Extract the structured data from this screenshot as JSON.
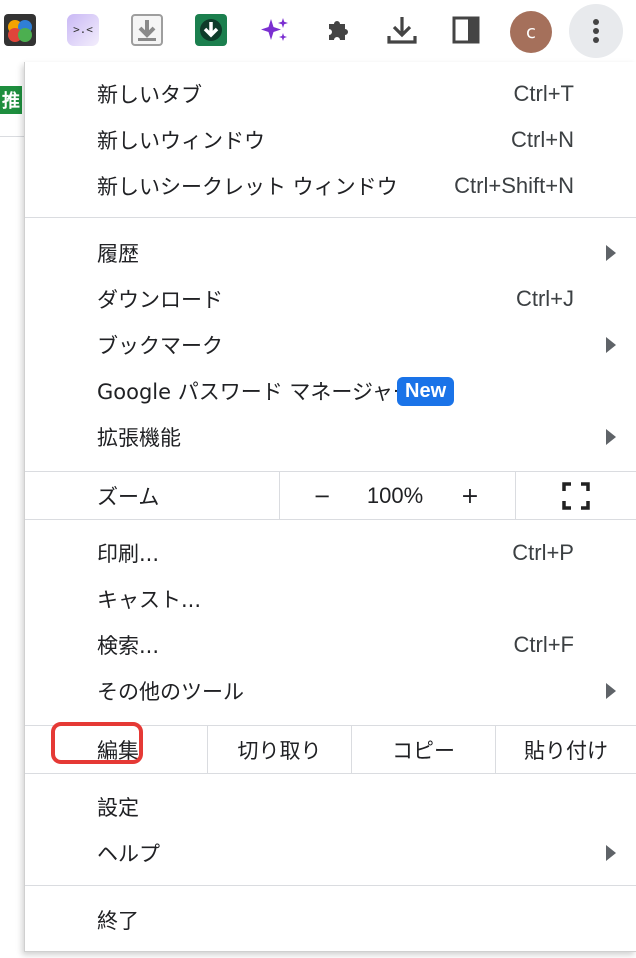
{
  "toolbar": {
    "extensions": [
      {
        "icon": "brain-extension-icon"
      },
      {
        "icon": "face-extension-icon",
        "glyph": ">.<"
      },
      {
        "icon": "download-arrow-extension-icon"
      },
      {
        "icon": "green-shield-download-icon"
      },
      {
        "icon": "sparkle-icon"
      },
      {
        "icon": "puzzle-extensions-icon"
      },
      {
        "icon": "downloads-icon"
      },
      {
        "icon": "side-panel-icon"
      }
    ],
    "avatar_letter": "c",
    "menu_icon": "three-dots-vertical-icon"
  },
  "page": {
    "badge_text": "推"
  },
  "menu": {
    "section1": [
      {
        "label": "新しいタブ",
        "shortcut": "Ctrl+T"
      },
      {
        "label": "新しいウィンドウ",
        "shortcut": "Ctrl+N"
      },
      {
        "label": "新しいシークレット ウィンドウ",
        "shortcut": "Ctrl+Shift+N"
      }
    ],
    "section2": [
      {
        "label": "履歴",
        "submenu": true
      },
      {
        "label": "ダウンロード",
        "shortcut": "Ctrl+J"
      },
      {
        "label": "ブックマーク",
        "submenu": true
      },
      {
        "label": "Google パスワード マネージャー",
        "badge": "New"
      },
      {
        "label": "拡張機能",
        "submenu": true
      }
    ],
    "zoom": {
      "label": "ズーム",
      "minus": "−",
      "value": "100%",
      "plus": "+",
      "fullscreen_icon": "fullscreen-icon"
    },
    "section3": [
      {
        "label": "印刷...",
        "shortcut": "Ctrl+P"
      },
      {
        "label": "キャスト..."
      },
      {
        "label": "検索...",
        "shortcut": "Ctrl+F"
      },
      {
        "label": "その他のツール",
        "submenu": true
      }
    ],
    "edit": {
      "label": "編集",
      "cut": "切り取り",
      "copy": "コピー",
      "paste": "貼り付け"
    },
    "section4": [
      {
        "label": "設定"
      },
      {
        "label": "ヘルプ",
        "submenu": true
      }
    ],
    "exit": {
      "label": "終了"
    }
  },
  "colors": {
    "accent": "#1a73e8",
    "highlight": "#e53935",
    "avatar": "#a5705b"
  }
}
